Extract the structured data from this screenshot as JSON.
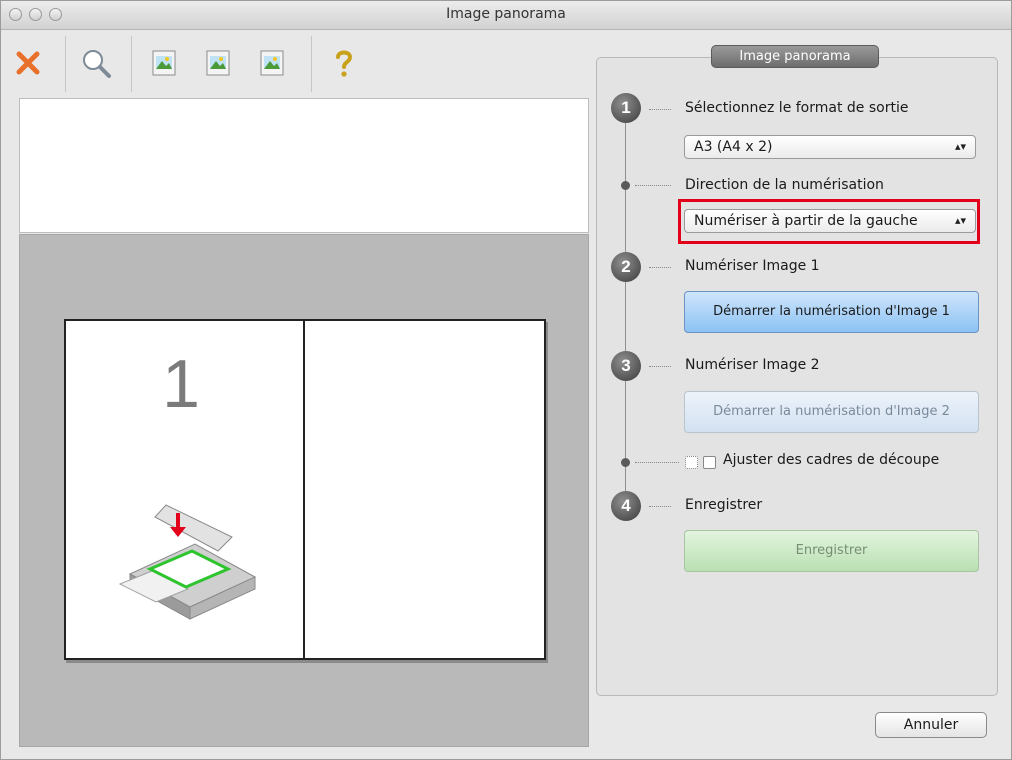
{
  "window": {
    "title": "Image panorama"
  },
  "toolbar": {
    "icons": [
      "delete-icon",
      "zoom-icon",
      "image-icon",
      "image-icon",
      "image-icon",
      "help-icon"
    ]
  },
  "preview": {
    "page_number": "1"
  },
  "panel": {
    "header": "Image panorama",
    "step1": {
      "number": "1",
      "label": "Sélectionnez le format de sortie",
      "format_value": "A3 (A4 x 2)"
    },
    "direction": {
      "label": "Direction de la numérisation",
      "value": "Numériser à partir de la gauche"
    },
    "step2": {
      "number": "2",
      "label": "Numériser Image 1",
      "button": "Démarrer la numérisation d'Image 1"
    },
    "step3": {
      "number": "3",
      "label": "Numériser Image 2",
      "button": "Démarrer la numérisation d'Image 2"
    },
    "crop": {
      "label": "Ajuster des cadres de découpe",
      "checked": false
    },
    "step4": {
      "number": "4",
      "label": "Enregistrer",
      "button": "Enregistrer"
    }
  },
  "footer": {
    "cancel": "Annuler"
  },
  "colors": {
    "highlight": "#e3001b",
    "delete_icon": "#e8702a",
    "primary_button": "#8cc2f4",
    "save_button": "#b9e0b1"
  }
}
